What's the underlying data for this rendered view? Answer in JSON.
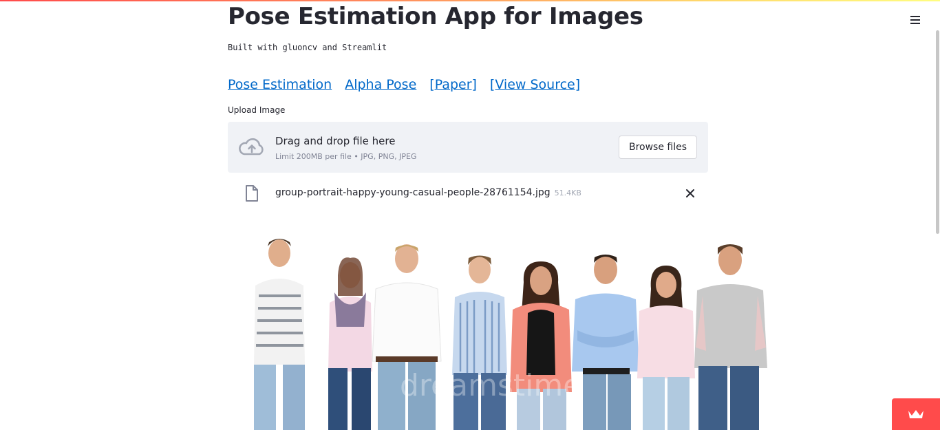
{
  "header": {
    "title": "Pose Estimation App for Images",
    "subtitle": "Built with gluoncv and Streamlit"
  },
  "links": [
    {
      "label": "Pose Estimation"
    },
    {
      "label": "Alpha Pose"
    },
    {
      "label": "[Paper]"
    },
    {
      "label": "[View Source]"
    }
  ],
  "uploader": {
    "label": "Upload Image",
    "drop_title": "Drag and drop file here",
    "limit_text": "Limit 200MB per file • JPG, PNG, JPEG",
    "browse_label": "Browse files"
  },
  "file": {
    "name": "group-portrait-happy-young-casual-people-28761154.jpg",
    "size": "51.4KB"
  },
  "image": {
    "watermark": "dreamstime"
  },
  "colors": {
    "accent": "#ff4b4b",
    "link": "#0068c9",
    "dropzone_bg": "#f0f2f6"
  },
  "icons": {
    "menu": "hamburger-menu-icon",
    "upload": "cloud-upload-icon",
    "file": "file-icon",
    "close": "close-icon",
    "app": "streamlit-crown-icon"
  }
}
